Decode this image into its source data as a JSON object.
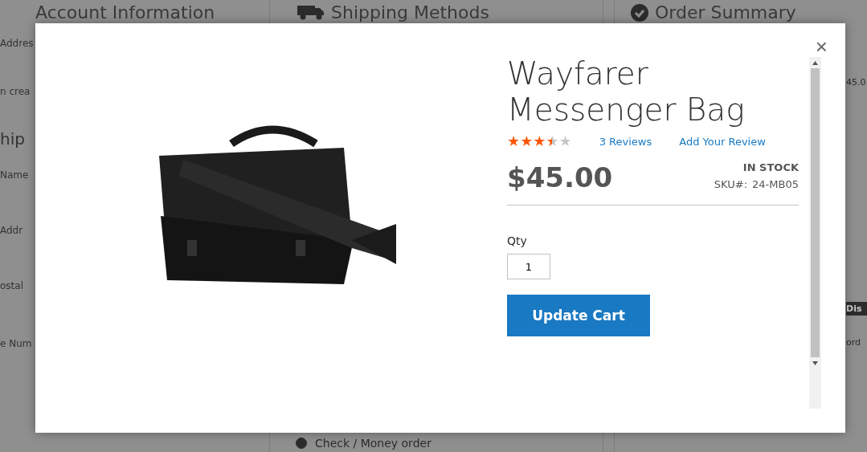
{
  "background": {
    "headings": [
      "Account Information",
      "Shipping Methods",
      "Order Summary"
    ],
    "left_texts": [
      "Addres",
      "n crea",
      "hip",
      "Name",
      "Addr",
      "ostal",
      "e Num"
    ],
    "right_texts": [
      "45.0",
      "Dis",
      "ord"
    ],
    "payment_option": {
      "label": "Check / Money order",
      "selected": true
    }
  },
  "modal": {
    "close": "×",
    "product": {
      "name": "Wayfarer Messenger Bag",
      "stars": 3.5,
      "reviews": "3  Reviews",
      "add_review": "Add Your Review",
      "price": "$45.00",
      "stock": "IN STOCK",
      "sku_label": "SKU#:",
      "sku": "24-MB05"
    },
    "qty": {
      "label": "Qty",
      "value": "1"
    },
    "button": "Update Cart"
  }
}
